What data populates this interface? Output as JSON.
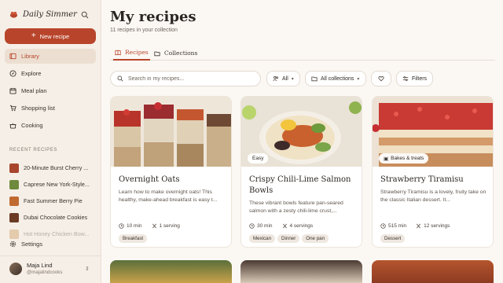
{
  "app": {
    "name": "Daily Simmer"
  },
  "sidebar": {
    "new_button": "New recipe",
    "nav": [
      {
        "label": "Library",
        "icon": "library-icon",
        "active": true
      },
      {
        "label": "Explore",
        "icon": "compass-icon",
        "active": false
      },
      {
        "label": "Meal plan",
        "icon": "calendar-icon",
        "active": false
      },
      {
        "label": "Shopping list",
        "icon": "cart-icon",
        "active": false
      },
      {
        "label": "Cooking",
        "icon": "pot-icon",
        "active": false
      }
    ],
    "recent_title": "RECENT RECIPES",
    "recent": [
      {
        "label": "20-Minute Burst Cherry ...",
        "color": "#a8452e"
      },
      {
        "label": "Caprese New York-Style...",
        "color": "#6f8a3c"
      },
      {
        "label": "Fast Summer Berry Pie",
        "color": "#c06a32"
      },
      {
        "label": "Dubai Chocolate Cookies",
        "color": "#6b3a23"
      },
      {
        "label": "Hot Honey Chicken Bow...",
        "color": "#c4893e"
      }
    ],
    "settings": "Settings",
    "user": {
      "name": "Maja Lind",
      "handle": "@majalindcooks"
    }
  },
  "main": {
    "title": "My recipes",
    "subtitle": "11 recipes in your collection",
    "tabs": [
      {
        "label": "Recipes",
        "icon": "book-icon",
        "active": true
      },
      {
        "label": "Collections",
        "icon": "folder-icon",
        "active": false
      }
    ],
    "search": {
      "placeholder": "Search in my recipes..."
    },
    "filters": {
      "people": "All",
      "collections": "All collections",
      "filters_label": "Filters"
    }
  },
  "cards": [
    {
      "title": "Overnight Oats",
      "description": "Learn how to make overnight oats! This healthy, make-ahead breakfast is easy t...",
      "time": "10 min",
      "servings": "1 serving",
      "tags": [
        "Breakfast"
      ],
      "badge": ""
    },
    {
      "title": "Crispy Chili-Lime Salmon Bowls",
      "description": "These vibrant bowls feature pan-seared salmon with a zesty chili-lime crust,...",
      "time": "30 min",
      "servings": "4 servings",
      "tags": [
        "Mexican",
        "Dinner",
        "One pan"
      ],
      "badge": "Easy"
    },
    {
      "title": "Strawberry Tiramisu",
      "description": "Strawberry Tiramisu is a lovely, fruity take on the classic Italian dessert. It...",
      "time": "515 min",
      "servings": "12 servings",
      "tags": [
        "Dessert"
      ],
      "badge": "Bakes & treats"
    }
  ],
  "colors": {
    "accent": "#b8452b",
    "sidebar_bg": "#f6efe7",
    "page_bg": "#fbf8f4"
  }
}
